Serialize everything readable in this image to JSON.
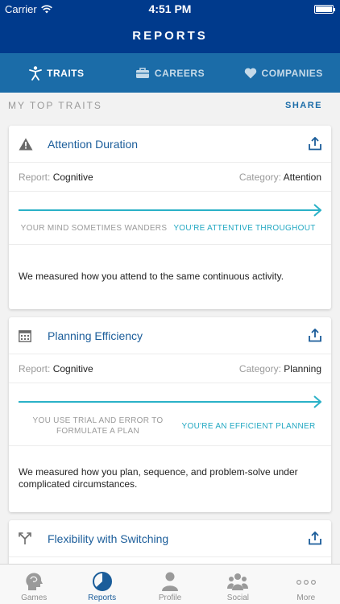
{
  "status_bar": {
    "carrier": "Carrier",
    "time": "4:51 PM"
  },
  "nav": {
    "title": "REPORTS"
  },
  "tabs": [
    {
      "label": "TRAITS",
      "icon": "figure-icon",
      "active": true
    },
    {
      "label": "CAREERS",
      "icon": "briefcase-icon",
      "active": false
    },
    {
      "label": "COMPANIES",
      "icon": "heart-icon",
      "active": false
    }
  ],
  "section": {
    "title": "MY TOP TRAITS",
    "share_label": "SHARE"
  },
  "report_label": "Report:",
  "category_label": "Category:",
  "cards": [
    {
      "title": "Attention Duration",
      "icon": "warning-icon",
      "report": "Cognitive",
      "category": "Attention",
      "scale_low": "YOUR MIND SOMETIMES WANDERS",
      "scale_high": "YOU'RE ATTENTIVE THROUGHOUT",
      "description": "We measured how you attend to the same continuous activity."
    },
    {
      "title": "Planning Efficiency",
      "icon": "calendar-icon",
      "report": "Cognitive",
      "category": "Planning",
      "scale_low": "YOU USE TRIAL AND ERROR TO FORMULATE A PLAN",
      "scale_high": "YOU'RE AN EFFICIENT PLANNER",
      "description": "We measured how you plan, sequence, and problem-solve under complicated circumstances."
    },
    {
      "title": "Flexibility with Switching",
      "icon": "split-arrows-icon"
    }
  ],
  "bottom_nav": [
    {
      "label": "Games",
      "icon": "head-icon",
      "active": false
    },
    {
      "label": "Reports",
      "icon": "pie-chart-icon",
      "active": true
    },
    {
      "label": "Profile",
      "icon": "person-icon",
      "active": false
    },
    {
      "label": "Social",
      "icon": "group-icon",
      "active": false
    },
    {
      "label": "More",
      "icon": "more-dots-icon",
      "active": false
    }
  ],
  "colors": {
    "nav_bg": "#003a8c",
    "tab_bg": "#1b6ca8",
    "accent": "#2ab1c7",
    "title_blue": "#1b5d9a"
  }
}
